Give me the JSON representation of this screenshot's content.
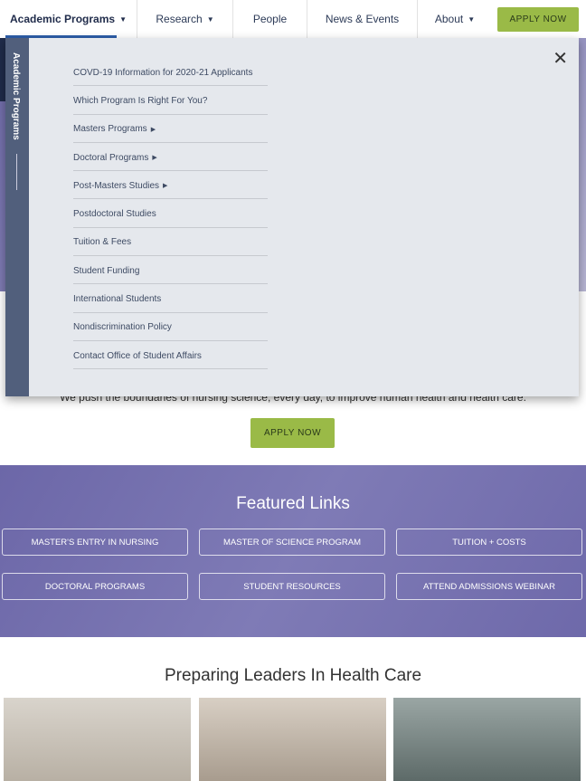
{
  "nav": {
    "items": [
      {
        "label": "Academic Programs",
        "caret": true
      },
      {
        "label": "Research",
        "caret": true
      },
      {
        "label": "People"
      },
      {
        "label": "News & Events"
      },
      {
        "label": "About",
        "caret": true
      }
    ],
    "apply": "APPLY NOW"
  },
  "menu": {
    "side_title": "Academic Programs",
    "close": "✕",
    "items": [
      "COVD-19 Information for 2020-21 Applicants",
      "Which Program Is Right For You?",
      "Masters Programs",
      "Doctoral Programs",
      "Post-Masters Studies",
      "Postdoctoral Studies",
      "Tuition & Fees",
      "Student Funding",
      "International Students",
      "Nondiscrimination Policy",
      "Contact Office of Student Affairs"
    ]
  },
  "tagline": "We push the boundaries of nursing science, every day, to improve human health and health care.",
  "apply_center": "APPLY NOW",
  "featured": {
    "title": "Featured Links",
    "links": [
      "MASTER'S ENTRY IN NURSING",
      "MASTER OF SCIENCE PROGRAM",
      "TUITION + COSTS",
      "DOCTORAL PROGRAMS",
      "STUDENT RESOURCES",
      "ATTEND ADMISSIONS WEBINAR"
    ]
  },
  "leaders": {
    "title": "Preparing Leaders In Health Care"
  },
  "colors": {
    "accent": "#9aba47",
    "navy": "#1f2b4a",
    "purple": "#7470b0"
  }
}
